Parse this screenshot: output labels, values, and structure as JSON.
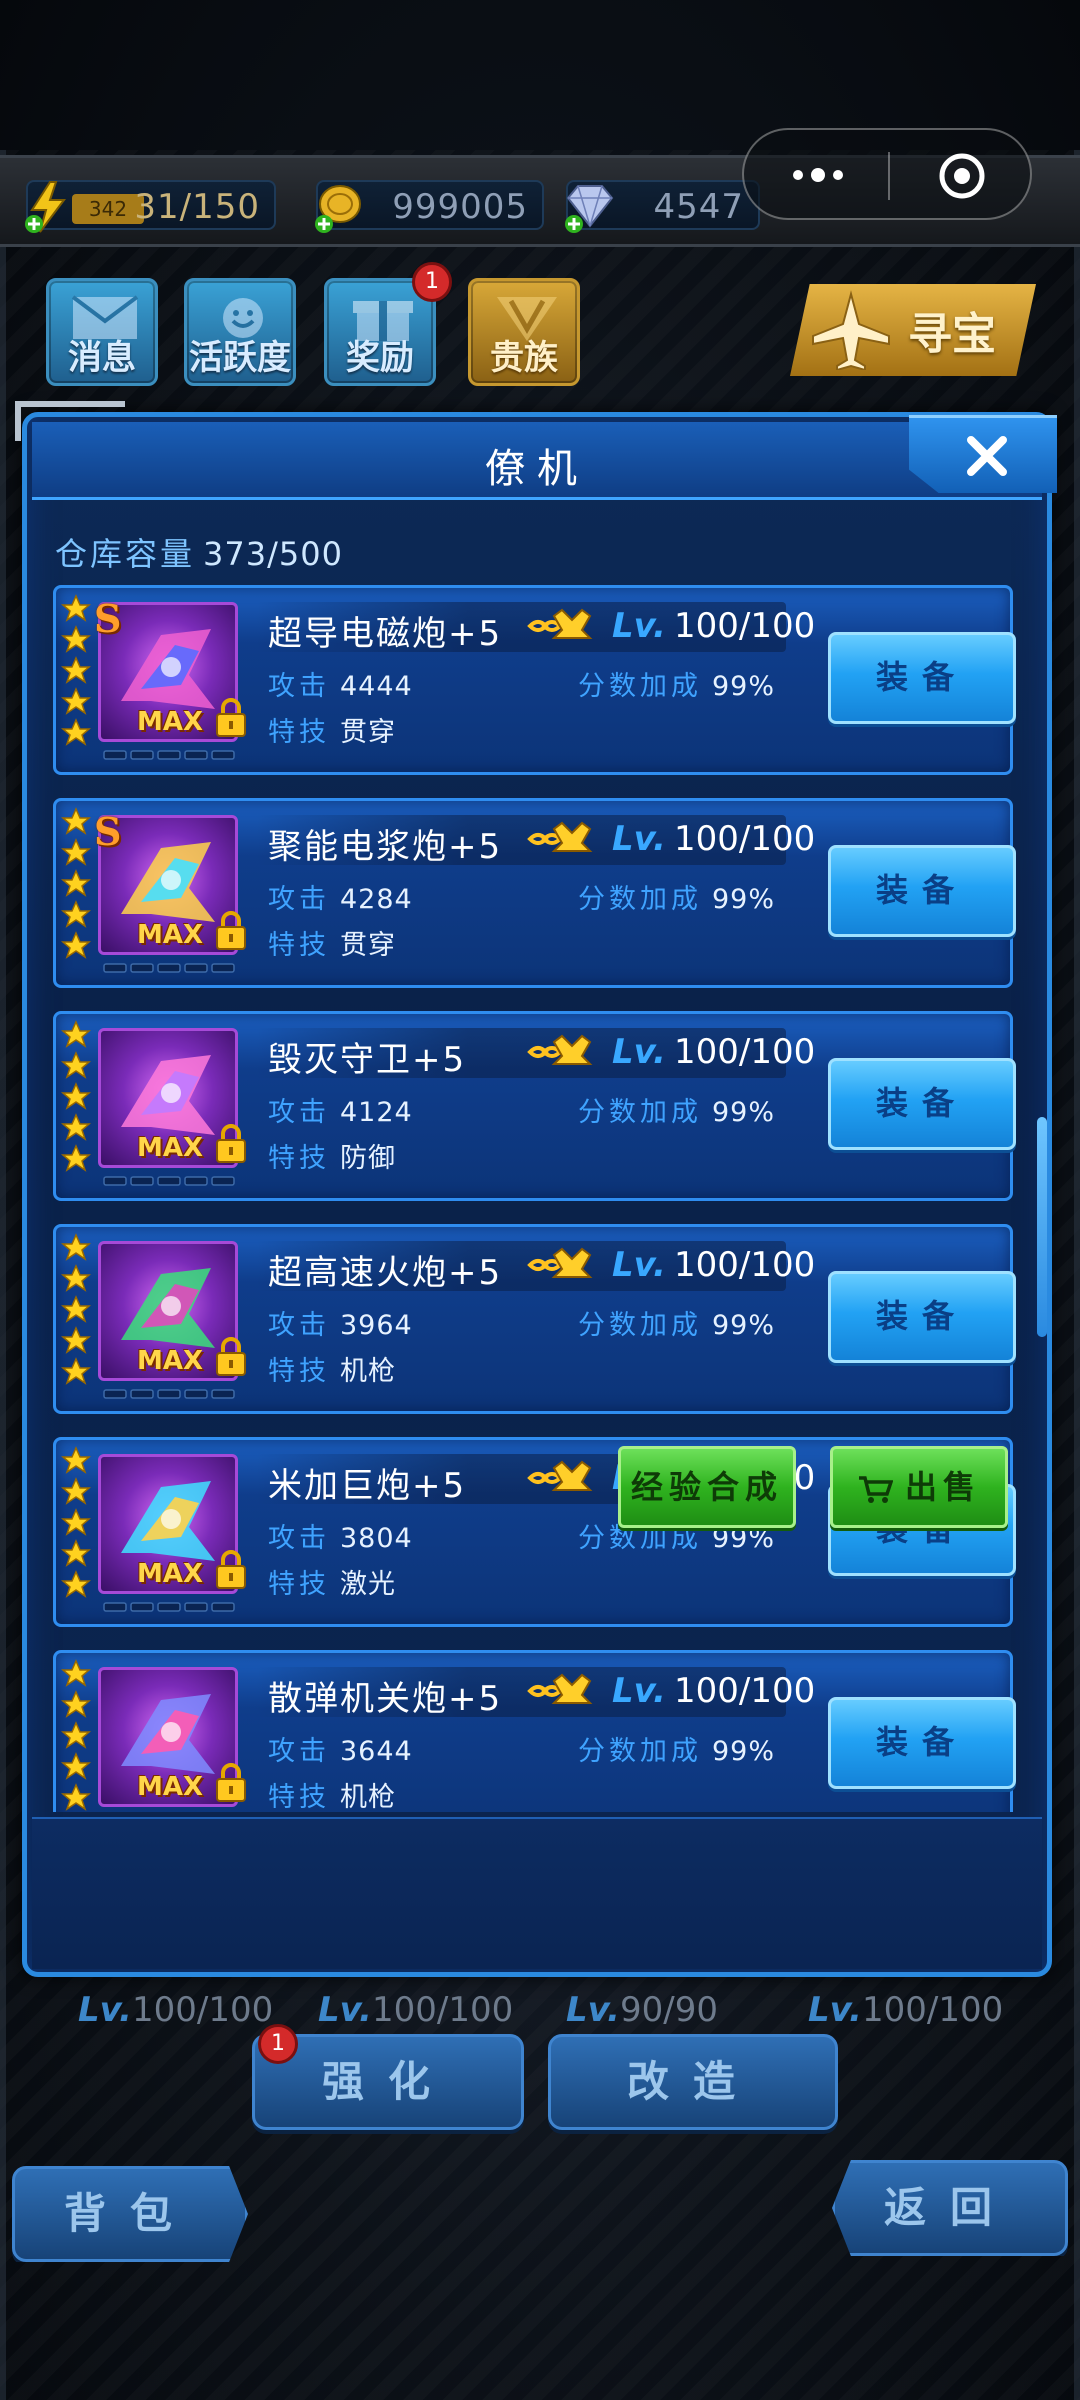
{
  "resources": {
    "energy_sub": "342",
    "energy": "31/150",
    "gold": "999005",
    "gems": "4547"
  },
  "menu": {
    "messages": "消息",
    "activity": "活跃度",
    "rewards": "奖励",
    "rewards_badge": "1",
    "noble": "贵族",
    "treasure": "寻宝"
  },
  "dialog": {
    "title": "僚机",
    "capacity_label": "仓库容量",
    "capacity_value": "373/500",
    "items": [
      {
        "name": "超导电磁炮+5",
        "rank": "S",
        "stars": 5,
        "max": "MAX",
        "lv_label": "Lv.",
        "level": "100/100",
        "atk_label": "攻击",
        "atk": "4444",
        "bonus_label": "分数加成",
        "bonus": "99%",
        "skill_label": "特技",
        "skill": "贯穿",
        "equip": "装备"
      },
      {
        "name": "聚能电浆炮+5",
        "rank": "S",
        "stars": 5,
        "max": "MAX",
        "lv_label": "Lv.",
        "level": "100/100",
        "atk_label": "攻击",
        "atk": "4284",
        "bonus_label": "分数加成",
        "bonus": "99%",
        "skill_label": "特技",
        "skill": "贯穿",
        "equip": "装备"
      },
      {
        "name": "毁灭守卫+5",
        "rank": "",
        "stars": 5,
        "max": "MAX",
        "lv_label": "Lv.",
        "level": "100/100",
        "atk_label": "攻击",
        "atk": "4124",
        "bonus_label": "分数加成",
        "bonus": "99%",
        "skill_label": "特技",
        "skill": "防御",
        "equip": "装备"
      },
      {
        "name": "超高速火炮+5",
        "rank": "",
        "stars": 5,
        "max": "MAX",
        "lv_label": "Lv.",
        "level": "100/100",
        "atk_label": "攻击",
        "atk": "3964",
        "bonus_label": "分数加成",
        "bonus": "99%",
        "skill_label": "特技",
        "skill": "机枪",
        "equip": "装备"
      },
      {
        "name": "米加巨炮+5",
        "rank": "",
        "stars": 5,
        "max": "MAX",
        "lv_label": "Lv.",
        "level": "100/100",
        "atk_label": "攻击",
        "atk": "3804",
        "bonus_label": "分数加成",
        "bonus": "99%",
        "skill_label": "特技",
        "skill": "激光",
        "equip": "装备"
      },
      {
        "name": "散弹机关炮+5",
        "rank": "",
        "stars": 5,
        "max": "MAX",
        "lv_label": "Lv.",
        "level": "100/100",
        "atk_label": "攻击",
        "atk": "3644",
        "bonus_label": "分数加成",
        "bonus": "99%",
        "skill_label": "特技",
        "skill": "机枪",
        "equip": "装备"
      }
    ],
    "merge_button": "经验合成",
    "sell_button": "出售"
  },
  "bottom": {
    "lv_label": "Lv.",
    "levels": [
      "100/100",
      "100/100",
      "90/90",
      "100/100"
    ],
    "strengthen": "强化",
    "strengthen_badge": "1",
    "modify": "改造",
    "bag": "背包",
    "back": "返回"
  },
  "colors": {
    "accent": "#2a8ae0",
    "card": "#0f3d8b",
    "equip": "#22a2f4",
    "green": "#2fb31f",
    "gold": "#d8a838"
  }
}
